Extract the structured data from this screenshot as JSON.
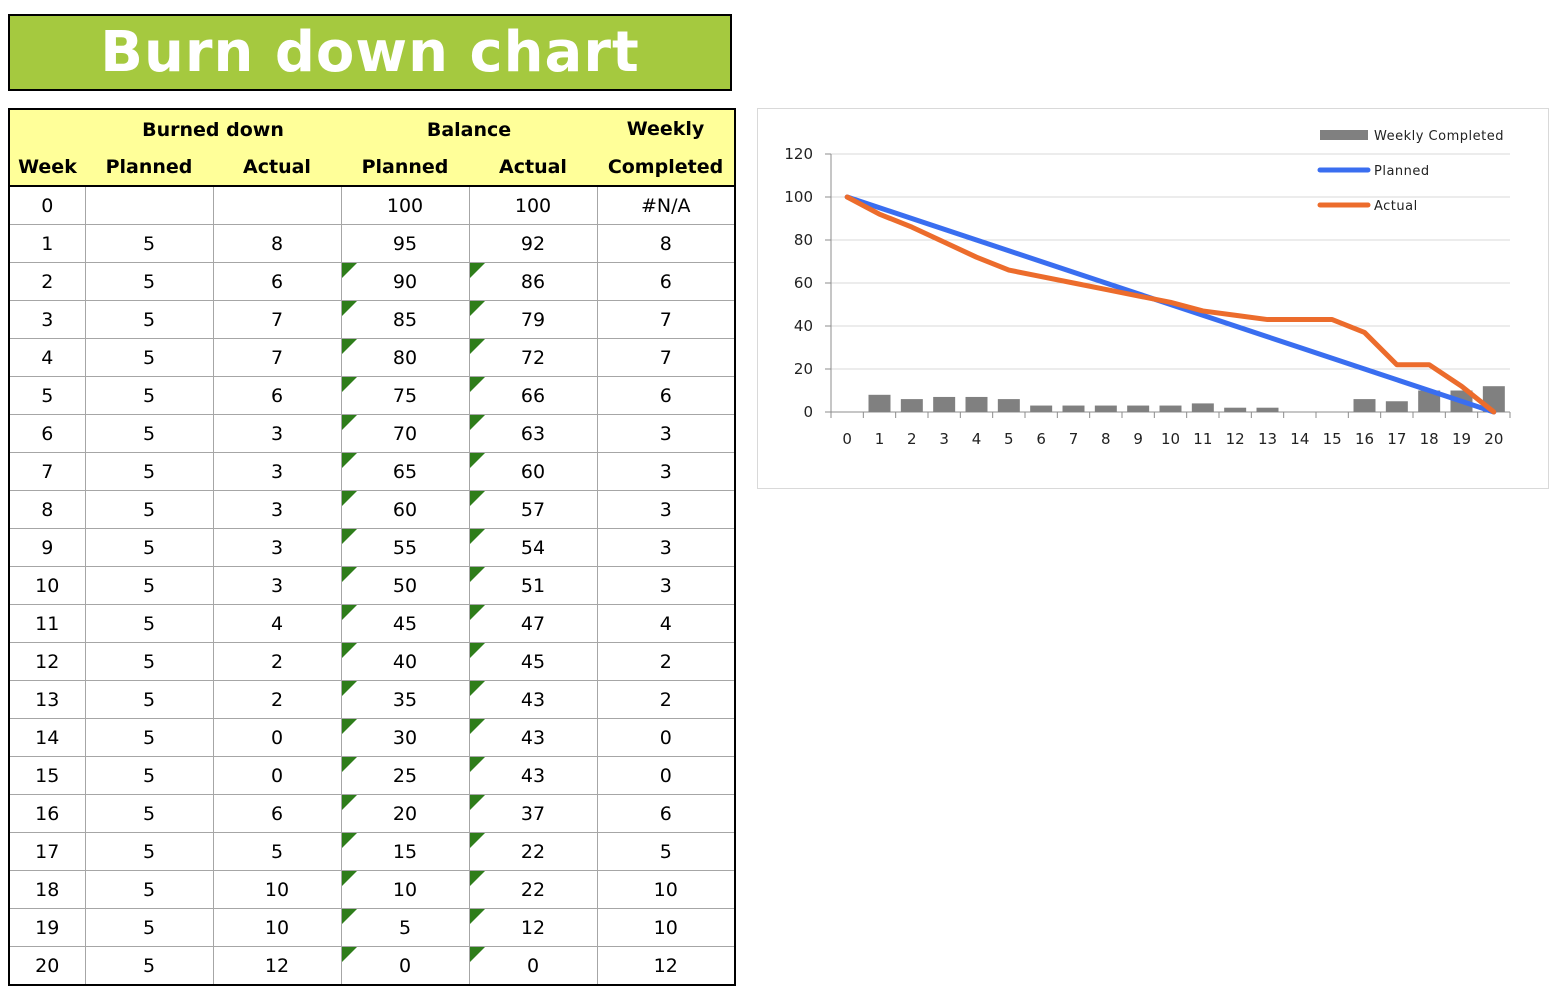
{
  "title": "Burn down chart",
  "table": {
    "group_headers": {
      "burned_down": "Burned down",
      "balance": "Balance",
      "weekly_top": "Weekly"
    },
    "sub_headers": {
      "week": "Week",
      "bd_planned": "Planned",
      "bd_actual": "Actual",
      "bal_planned": "Planned",
      "bal_actual": "Actual",
      "weekly_bottom": "Completed"
    },
    "rows": [
      {
        "week": "0",
        "bd_planned": "",
        "bd_actual": "",
        "bal_planned": "100",
        "bal_actual": "100",
        "weekly": "#N/A"
      },
      {
        "week": "1",
        "bd_planned": "5",
        "bd_actual": "8",
        "bal_planned": "95",
        "bal_actual": "92",
        "weekly": "8"
      },
      {
        "week": "2",
        "bd_planned": "5",
        "bd_actual": "6",
        "bal_planned": "90",
        "bal_actual": "86",
        "weekly": "6"
      },
      {
        "week": "3",
        "bd_planned": "5",
        "bd_actual": "7",
        "bal_planned": "85",
        "bal_actual": "79",
        "weekly": "7"
      },
      {
        "week": "4",
        "bd_planned": "5",
        "bd_actual": "7",
        "bal_planned": "80",
        "bal_actual": "72",
        "weekly": "7"
      },
      {
        "week": "5",
        "bd_planned": "5",
        "bd_actual": "6",
        "bal_planned": "75",
        "bal_actual": "66",
        "weekly": "6"
      },
      {
        "week": "6",
        "bd_planned": "5",
        "bd_actual": "3",
        "bal_planned": "70",
        "bal_actual": "63",
        "weekly": "3"
      },
      {
        "week": "7",
        "bd_planned": "5",
        "bd_actual": "3",
        "bal_planned": "65",
        "bal_actual": "60",
        "weekly": "3"
      },
      {
        "week": "8",
        "bd_planned": "5",
        "bd_actual": "3",
        "bal_planned": "60",
        "bal_actual": "57",
        "weekly": "3"
      },
      {
        "week": "9",
        "bd_planned": "5",
        "bd_actual": "3",
        "bal_planned": "55",
        "bal_actual": "54",
        "weekly": "3"
      },
      {
        "week": "10",
        "bd_planned": "5",
        "bd_actual": "3",
        "bal_planned": "50",
        "bal_actual": "51",
        "weekly": "3"
      },
      {
        "week": "11",
        "bd_planned": "5",
        "bd_actual": "4",
        "bal_planned": "45",
        "bal_actual": "47",
        "weekly": "4"
      },
      {
        "week": "12",
        "bd_planned": "5",
        "bd_actual": "2",
        "bal_planned": "40",
        "bal_actual": "45",
        "weekly": "2"
      },
      {
        "week": "13",
        "bd_planned": "5",
        "bd_actual": "2",
        "bal_planned": "35",
        "bal_actual": "43",
        "weekly": "2"
      },
      {
        "week": "14",
        "bd_planned": "5",
        "bd_actual": "0",
        "bal_planned": "30",
        "bal_actual": "43",
        "weekly": "0"
      },
      {
        "week": "15",
        "bd_planned": "5",
        "bd_actual": "0",
        "bal_planned": "25",
        "bal_actual": "43",
        "weekly": "0"
      },
      {
        "week": "16",
        "bd_planned": "5",
        "bd_actual": "6",
        "bal_planned": "20",
        "bal_actual": "37",
        "weekly": "6"
      },
      {
        "week": "17",
        "bd_planned": "5",
        "bd_actual": "5",
        "bal_planned": "15",
        "bal_actual": "22",
        "weekly": "5"
      },
      {
        "week": "18",
        "bd_planned": "5",
        "bd_actual": "10",
        "bal_planned": "10",
        "bal_actual": "22",
        "weekly": "10"
      },
      {
        "week": "19",
        "bd_planned": "5",
        "bd_actual": "10",
        "bal_planned": "5",
        "bal_actual": "12",
        "weekly": "10"
      },
      {
        "week": "20",
        "bd_planned": "5",
        "bd_actual": "12",
        "bal_planned": "0",
        "bal_actual": "0",
        "weekly": "12"
      }
    ],
    "colors": {
      "header_bg": "#ffff99",
      "title_bg": "#a5c93f",
      "note_flag": "#2e7d1a"
    }
  },
  "chart_data": {
    "type": "bar+line",
    "categories": [
      "0",
      "1",
      "2",
      "3",
      "4",
      "5",
      "6",
      "7",
      "8",
      "9",
      "10",
      "11",
      "12",
      "13",
      "14",
      "15",
      "16",
      "17",
      "18",
      "19",
      "20"
    ],
    "series": [
      {
        "name": "Weekly Completed",
        "kind": "bar",
        "color": "#808080",
        "values": [
          null,
          8,
          6,
          7,
          7,
          6,
          3,
          3,
          3,
          3,
          3,
          4,
          2,
          2,
          0,
          0,
          6,
          5,
          10,
          10,
          12
        ]
      },
      {
        "name": "Planned",
        "kind": "line",
        "color": "#3a6ef0",
        "values": [
          100,
          95,
          90,
          85,
          80,
          75,
          70,
          65,
          60,
          55,
          50,
          45,
          40,
          35,
          30,
          25,
          20,
          15,
          10,
          5,
          0
        ]
      },
      {
        "name": "Actual",
        "kind": "line",
        "color": "#ec6c2c",
        "values": [
          100,
          92,
          86,
          79,
          72,
          66,
          63,
          60,
          57,
          54,
          51,
          47,
          45,
          43,
          43,
          43,
          37,
          22,
          22,
          12,
          0
        ]
      }
    ],
    "ylim": [
      0,
      120
    ],
    "yticks": [
      "0",
      "20",
      "40",
      "60",
      "80",
      "100",
      "120"
    ],
    "grid": true,
    "legend_position": "top-right"
  }
}
